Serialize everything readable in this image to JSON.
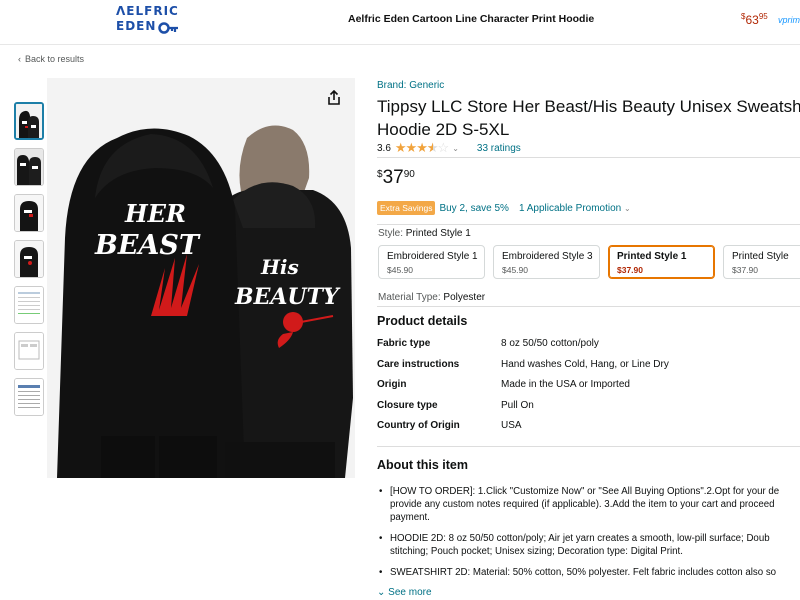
{
  "banner": {
    "logo_line1": "ΛELFRIC",
    "logo_line2": "EDEN",
    "title": "Aelfric Eden Cartoon Line Character Print Hoodie",
    "price_symbol": "$",
    "price_whole": "63",
    "price_fraction": "95",
    "prime_label": "vprim"
  },
  "nav": {
    "back_label": "Back to results"
  },
  "product": {
    "brand_link": "Brand: Generic",
    "title_line1": "Tippsy LLC Store Her Beast/His Beauty Unisex Sweatsh",
    "title_line2": "Hoodie 2D S-5XL",
    "rating_value": "3.6",
    "rating_stars": 3.6,
    "ratings_count_label": "33 ratings",
    "price_symbol": "$",
    "price_whole": "37",
    "price_fraction": "90",
    "promo_badge": "Extra Savings",
    "promo_text": "Buy 2, save 5%",
    "promo_link": "1 Applicable Promotion",
    "style_label": "Style:",
    "style_selected": "Printed Style 1",
    "style_options": [
      {
        "name": "Embroidered Style 1",
        "price": "$45.90"
      },
      {
        "name": "Embroidered Style 3",
        "price": "$45.90"
      },
      {
        "name": "Printed Style 1",
        "price": "$37.90",
        "selected": true
      },
      {
        "name": "Printed Style",
        "price": "$37.90"
      }
    ],
    "material_label": "Material Type:",
    "material_value": "Polyester"
  },
  "image": {
    "her_text_1": "HER",
    "her_text_2": "BEAST",
    "his_text_1": "His",
    "his_text_2": "BEAUTY",
    "hoodie_color": "#141414",
    "accent_red": "#d11a1a"
  },
  "details": {
    "heading": "Product details",
    "rows": [
      {
        "key": "Fabric type",
        "value": "8 oz 50/50 cotton/poly"
      },
      {
        "key": "Care instructions",
        "value": "Hand washes Cold, Hang, or Line Dry"
      },
      {
        "key": "Origin",
        "value": "Made in the USA or Imported"
      },
      {
        "key": "Closure type",
        "value": "Pull On"
      },
      {
        "key": "Country of Origin",
        "value": "USA"
      }
    ]
  },
  "about": {
    "heading": "About this item",
    "bullets": [
      {
        "l1": "[HOW TO ORDER]: 1.Click \"Customize Now\" or \"See All Buying Options\".2.Opt for your de",
        "l2": "provide any custom notes required (if applicable). 3.Add the item to your cart and proceed",
        "l3": "payment."
      },
      {
        "l1": "HOODIE 2D: 8 oz 50/50 cotton/poly; Air jet yarn creates a smooth, low-pill surface; Doub",
        "l2": "stitching; Pouch pocket; Unisex sizing; Decoration type: Digital Print.",
        "l3": ""
      },
      {
        "l1": "SWEATSHIRT 2D: Material: 50% cotton, 50% polyester. Felt fabric includes cotton also so",
        "l2": "",
        "l3": ""
      }
    ],
    "see_more": "See more"
  }
}
